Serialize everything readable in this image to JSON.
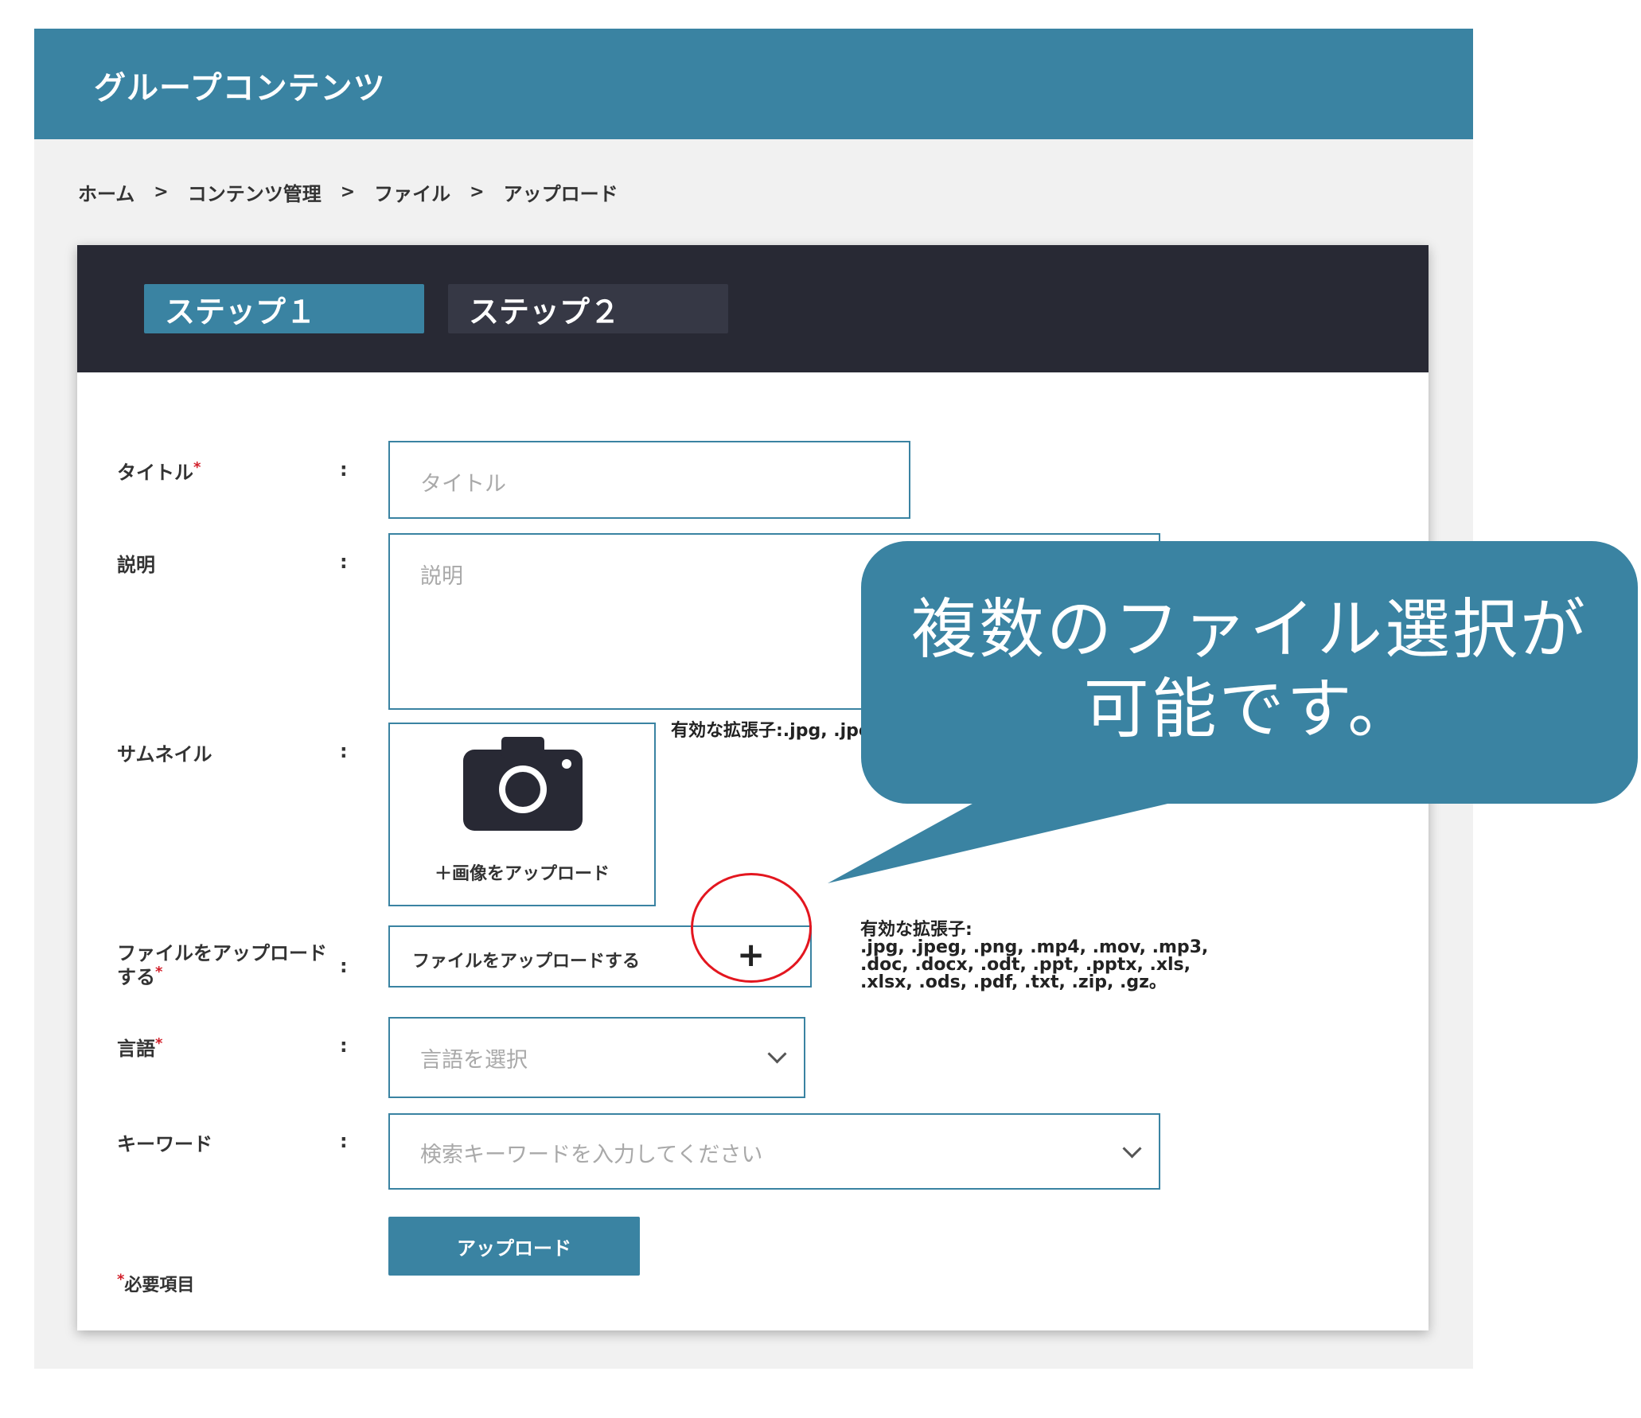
{
  "header": {
    "title": "グループコンテンツ"
  },
  "breadcrumb": {
    "items": [
      "ホーム",
      "コンテンツ管理",
      "ファイル",
      "アップロード"
    ],
    "separator": ">"
  },
  "steps": {
    "step1": "ステップ１",
    "step2": "ステップ２"
  },
  "form": {
    "colon": ":",
    "required_mark": "*",
    "title": {
      "label": "タイトル",
      "placeholder": "タイトル"
    },
    "description": {
      "label": "説明",
      "placeholder": "説明"
    },
    "thumbnail": {
      "label": "サムネイル",
      "upload_label": "＋画像をアップロード",
      "extensions": "有効な拡張子:.jpg, .jpe"
    },
    "file_upload": {
      "label_line1": "ファイルをアップロード",
      "label_line2": "する",
      "button_label": "ファイルをアップロードする",
      "plus": "+",
      "extensions_title": "有効な拡張子:",
      "extensions_line1": ".jpg, .jpeg, .png, .mp4, .mov, .mp3,",
      "extensions_line2": ".doc, .docx, .odt, .ppt, .pptx, .xls,",
      "extensions_line3": ".xlsx, .ods, .pdf, .txt, .zip, .gz。"
    },
    "language": {
      "label": "言語",
      "placeholder": "言語を選択"
    },
    "keyword": {
      "label": "キーワード",
      "placeholder": "検索キーワードを入力してください"
    },
    "submit_label": "アップロード",
    "required_note": "必要項目"
  },
  "callout": {
    "line1": "複数のファイル選択が",
    "line2": "可能です。"
  },
  "colors": {
    "accent": "#3a83a2",
    "dark": "#282934",
    "highlight": "#e3161f"
  },
  "icons": [
    "camera-icon",
    "plus-icon",
    "chevron-down-icon"
  ]
}
